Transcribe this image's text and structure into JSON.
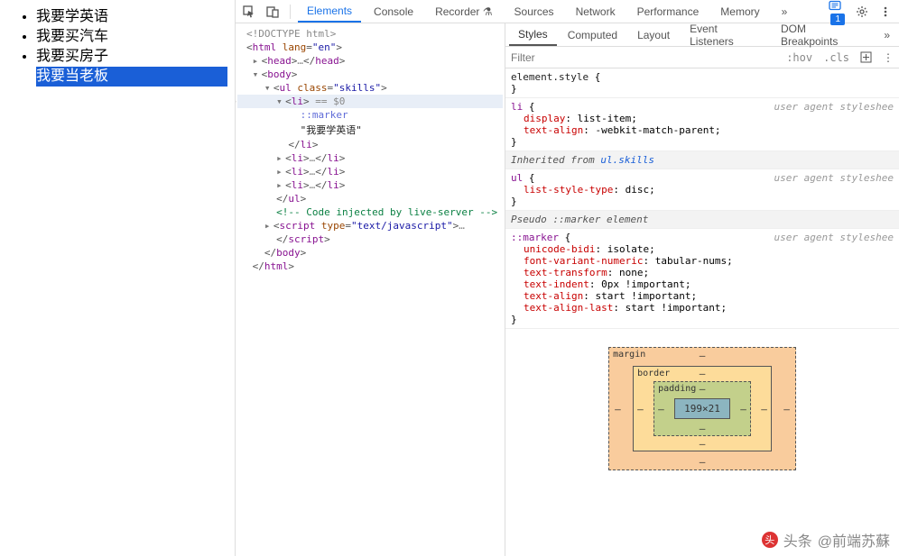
{
  "page": {
    "items": [
      "我要学英语",
      "我要买汽车",
      "我要买房子",
      "我要当老板"
    ],
    "selectedIndex": 3
  },
  "devtools": {
    "topTabs": [
      "Elements",
      "Console",
      "Recorder",
      "Sources",
      "Network",
      "Performance",
      "Memory"
    ],
    "activeTopTab": 0,
    "issuesBadge": "1",
    "moreGlyph": "»",
    "elementsTree": {
      "doctype": "<!DOCTYPE html>",
      "htmlOpen": "html",
      "htmlLang": "lang",
      "htmlLangVal": "\"en\"",
      "headCollapsed": "head",
      "bodyOpen": "body",
      "ulOpen": "ul",
      "ulClassAttr": "class",
      "ulClassVal": "\"skills\"",
      "liSelected": "li",
      "eqDollar0": " == $0",
      "marker": "::marker",
      "liText": "\"我要学英语\"",
      "liClose": "li",
      "liCollapsed": "li",
      "ulClose": "ul",
      "comment": "<!-- Code injected by live-server -->",
      "scriptTag": "script",
      "scriptTypeAttr": "type",
      "scriptTypeVal": "\"text/javascript\"",
      "scriptClose": "script",
      "bodyClose": "body",
      "htmlClose": "html",
      "ellipsis": "…"
    },
    "stylesTabs": [
      "Styles",
      "Computed",
      "Layout",
      "Event Listeners",
      "DOM Breakpoints"
    ],
    "activeStylesTab": 0,
    "filterPlaceholder": "Filter",
    "hov": ":hov",
    "cls": ".cls",
    "rules": {
      "elementStyle": {
        "selector": "element.style",
        "open": "{",
        "close": "}"
      },
      "liRule": {
        "selector": "li",
        "source": "user agent styleshee",
        "props": [
          {
            "name": "display",
            "val": "list-item;"
          },
          {
            "name": "text-align",
            "val": "-webkit-match-parent;"
          }
        ]
      },
      "inheritedHeader": "Inherited from ",
      "inheritedLink": "ul.skills",
      "ulRule": {
        "selector": "ul",
        "source": "user agent styleshee",
        "props": [
          {
            "name": "list-style-type",
            "val": "disc;"
          }
        ]
      },
      "pseudoHeader": "Pseudo ::marker element",
      "markerRule": {
        "selector": "::marker",
        "source": "user agent styleshee",
        "props": [
          {
            "name": "unicode-bidi",
            "val": "isolate;"
          },
          {
            "name": "font-variant-numeric",
            "val": "tabular-nums;"
          },
          {
            "name": "text-transform",
            "val": "none;"
          },
          {
            "name": "text-indent",
            "val": "0px !important;"
          },
          {
            "name": "text-align",
            "val": "start !important;"
          },
          {
            "name": "text-align-last",
            "val": "start !important;"
          }
        ]
      }
    },
    "boxModel": {
      "margin": "margin",
      "border": "border",
      "padding": "padding",
      "content": "199×21",
      "dash": "–"
    }
  },
  "watermark": {
    "prefix": "头条",
    "author": "@前端苏蘇"
  }
}
